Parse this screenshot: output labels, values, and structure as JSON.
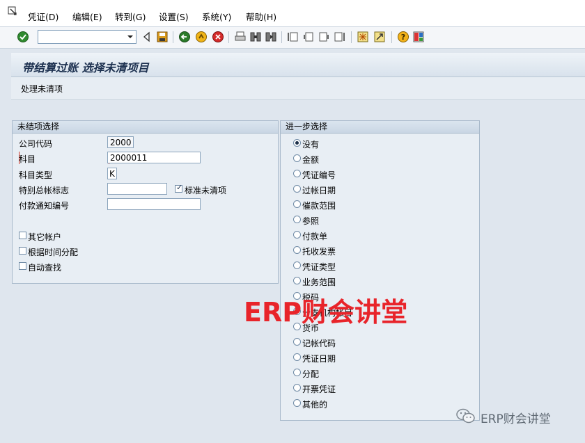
{
  "menu": {
    "items": [
      "凭证(D)",
      "编辑(E)",
      "转到(G)",
      "设置(S)",
      "系统(Y)",
      "帮助(H)"
    ]
  },
  "toolbar": {
    "command_value": "",
    "icons": [
      "enter-icon",
      "save-icon",
      "back-icon",
      "exit-icon",
      "cancel-icon",
      "print-icon",
      "find-icon",
      "find-next-icon",
      "first-page-icon",
      "prev-page-icon",
      "next-page-icon",
      "last-page-icon",
      "new-session-icon",
      "shortcut-icon",
      "help-icon",
      "layout-icon"
    ]
  },
  "page": {
    "title": "带结算过账 选择未清项目",
    "app_button": "处理未清项"
  },
  "left_group": {
    "title": "未结项选择",
    "company_code_label": "公司代码",
    "company_code_value": "2000",
    "account_label": "科目",
    "account_value": "2000011",
    "account_type_label": "科目类型",
    "account_type_value": "K",
    "special_gl_label": "特别总帐标志",
    "special_gl_value": "",
    "standard_oi_label": "标准未清项",
    "standard_oi_checked": true,
    "payment_advice_label": "付款通知编号",
    "payment_advice_value": "",
    "other_accounts_label": "其它帐户",
    "distribute_by_age_label": "根据时间分配",
    "auto_search_label": "自动查找"
  },
  "right_group": {
    "title": "进一步选择",
    "selected_index": 0,
    "options": [
      "没有",
      "金额",
      "凭证编号",
      "过帐日期",
      "催款范围",
      "参照",
      "付款单",
      "托收发票",
      "凭证类型",
      "业务范围",
      "税码",
      "分支机构帐目",
      "货币",
      "记帐代码",
      "凭证日期",
      "分配",
      "开票凭证",
      "其他的"
    ]
  },
  "watermark": {
    "red_text": "ERP财会讲堂",
    "gray_text": "ERP财会讲堂"
  },
  "colors": {
    "accent_red": "#e8242a",
    "frame_blue": "#a8b9cb"
  }
}
